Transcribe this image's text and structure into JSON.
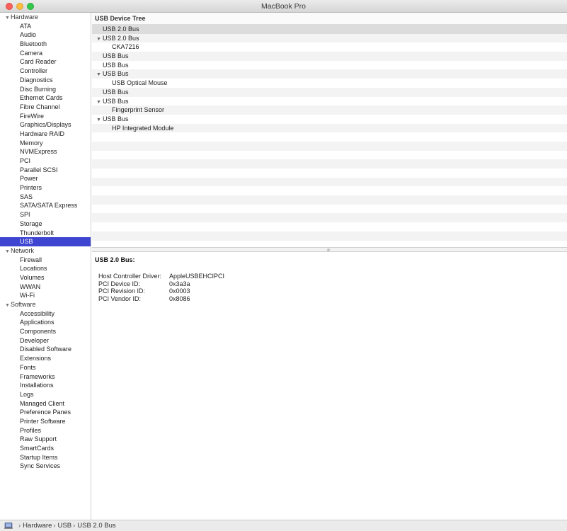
{
  "window": {
    "title": "MacBook Pro"
  },
  "sidebar": {
    "groups": [
      {
        "label": "Hardware",
        "items": [
          "ATA",
          "Audio",
          "Bluetooth",
          "Camera",
          "Card Reader",
          "Controller",
          "Diagnostics",
          "Disc Burning",
          "Ethernet Cards",
          "Fibre Channel",
          "FireWire",
          "Graphics/Displays",
          "Hardware RAID",
          "Memory",
          "NVMExpress",
          "PCI",
          "Parallel SCSI",
          "Power",
          "Printers",
          "SAS",
          "SATA/SATA Express",
          "SPI",
          "Storage",
          "Thunderbolt",
          "USB"
        ]
      },
      {
        "label": "Network",
        "items": [
          "Firewall",
          "Locations",
          "Volumes",
          "WWAN",
          "Wi-Fi"
        ]
      },
      {
        "label": "Software",
        "items": [
          "Accessibility",
          "Applications",
          "Components",
          "Developer",
          "Disabled Software",
          "Extensions",
          "Fonts",
          "Frameworks",
          "Installations",
          "Logs",
          "Managed Client",
          "Preference Panes",
          "Printer Software",
          "Profiles",
          "Raw Support",
          "SmartCards",
          "Startup Items",
          "Sync Services"
        ]
      }
    ],
    "selected": "USB"
  },
  "tree": {
    "header": "USB Device Tree",
    "rows": [
      {
        "label": "USB 2.0 Bus",
        "level": 0,
        "expandable": false,
        "selected": true
      },
      {
        "label": "USB 2.0 Bus",
        "level": 0,
        "expandable": true
      },
      {
        "label": "CKA7216",
        "level": 1
      },
      {
        "label": "USB Bus",
        "level": 0,
        "expandable": false
      },
      {
        "label": "USB Bus",
        "level": 0,
        "expandable": false
      },
      {
        "label": "USB Bus",
        "level": 0,
        "expandable": true
      },
      {
        "label": "USB Optical Mouse",
        "level": 1
      },
      {
        "label": "USB Bus",
        "level": 0,
        "expandable": false
      },
      {
        "label": "USB Bus",
        "level": 0,
        "expandable": true
      },
      {
        "label": "Fingerprint Sensor",
        "level": 1
      },
      {
        "label": "USB Bus",
        "level": 0,
        "expandable": true
      },
      {
        "label": "HP Integrated Module",
        "level": 1
      }
    ],
    "total_rows": 24
  },
  "detail": {
    "title": "USB 2.0 Bus:",
    "fields": [
      {
        "key": "Host Controller Driver:",
        "value": "AppleUSBEHCIPCI"
      },
      {
        "key": "PCI Device ID:",
        "value": "0x3a3a"
      },
      {
        "key": "PCI Revision ID:",
        "value": "0x0003"
      },
      {
        "key": "PCI Vendor ID:",
        "value": "0x8086"
      }
    ]
  },
  "statusbar": {
    "icon": "computer-icon",
    "breadcrumb": [
      "Hardware",
      "USB",
      "USB 2.0 Bus"
    ],
    "separator": "›"
  },
  "colors": {
    "selection": "#3d45d1",
    "row_alt": "#f3f3f3",
    "row_selected": "#dcdcdc"
  }
}
